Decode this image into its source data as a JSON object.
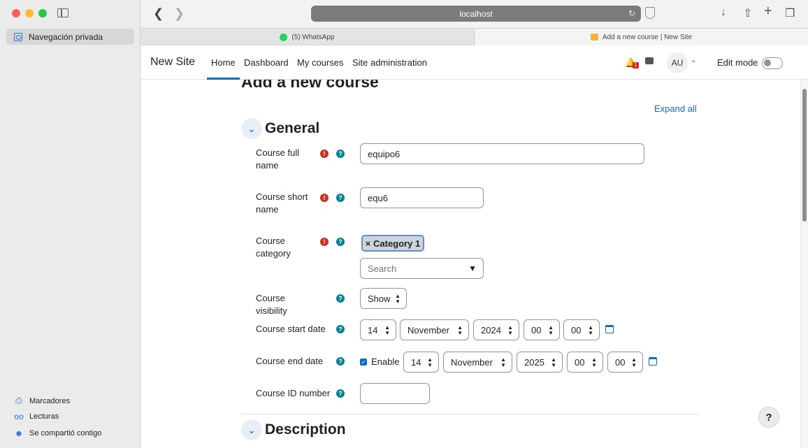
{
  "sidebar": {
    "active_tab": "Navegación privada",
    "bottom": [
      "Marcadores",
      "Lecturas",
      "Se compartió contigo"
    ]
  },
  "toolbar": {
    "address": "localhost"
  },
  "tabs": [
    {
      "label": "(5) WhatsApp"
    },
    {
      "label": "Add a new course | New Site"
    }
  ],
  "navbar": {
    "brand": "New Site",
    "links": [
      "Home",
      "Dashboard",
      "My courses",
      "Site administration"
    ],
    "notification_count": "1",
    "avatar": "AU",
    "edit_mode": "Edit mode"
  },
  "main": {
    "title": "Add a new course",
    "expand_all": "Expand all",
    "general": "General",
    "description": "Description",
    "fields": {
      "full_name": {
        "label": "Course full name",
        "value": "equipo6"
      },
      "short_name": {
        "label": "Course short name",
        "value": "equ6"
      },
      "category": {
        "label": "Course category",
        "chip": "× Category 1",
        "placeholder": "Search"
      },
      "visibility": {
        "label": "Course visibility",
        "value": "Show"
      },
      "start_date": {
        "label": "Course start date",
        "day": "14",
        "month": "November",
        "year": "2024",
        "hour": "00",
        "minute": "00"
      },
      "end_date": {
        "label": "Course end date",
        "enable": "Enable",
        "day": "14",
        "month": "November",
        "year": "2025",
        "hour": "00",
        "minute": "00"
      },
      "id_number": {
        "label": "Course ID number",
        "value": ""
      }
    },
    "help_button": "?"
  }
}
